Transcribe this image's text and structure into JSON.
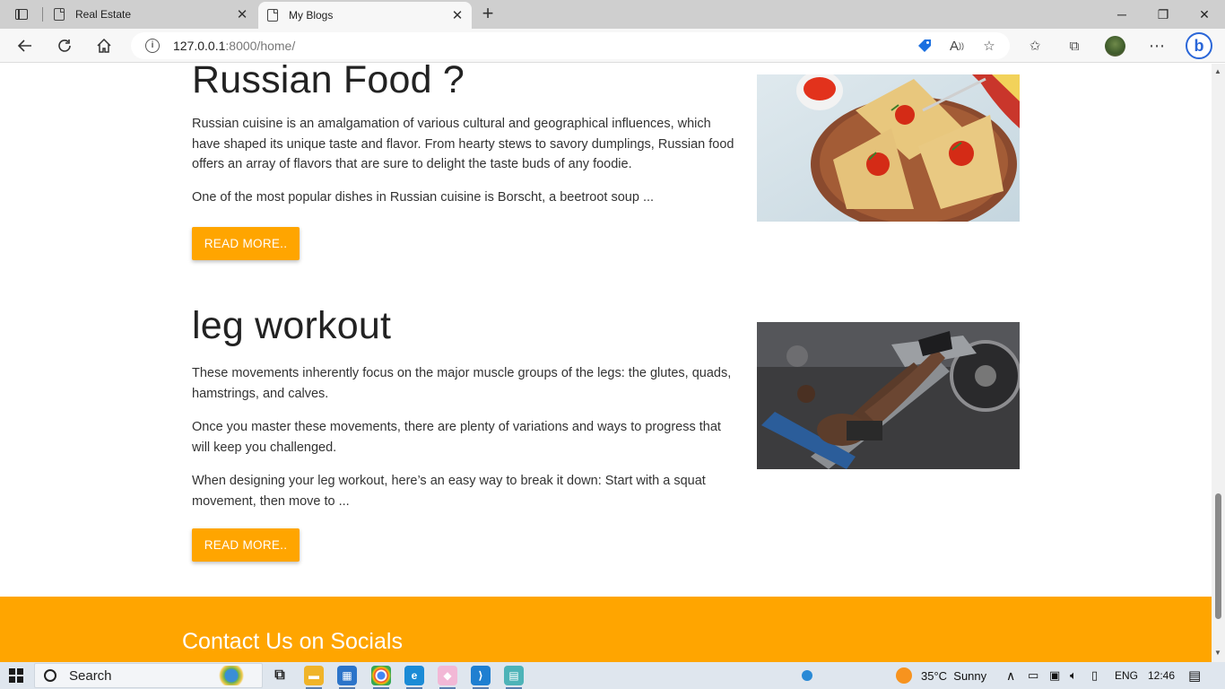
{
  "browser": {
    "tabs": [
      {
        "title": "Real Estate",
        "active": false
      },
      {
        "title": "My Blogs",
        "active": true
      }
    ],
    "url_host": "127.0.0.1",
    "url_rest": ":8000/home/",
    "window_controls": {
      "minimize": "─",
      "restore": "❐",
      "close": "✕"
    },
    "new_tab": "+"
  },
  "posts": [
    {
      "title": "Russian Food ?",
      "paragraphs": [
        "Russian cuisine is an amalgamation of various cultural and geographical influences, which have shaped its unique taste and flavor. From hearty stews to savory dumplings, Russian food offers an array of flavors that are sure to delight the taste buds of any foodie.",
        "One of the most popular dishes in Russian cuisine is Borscht, a beetroot soup ..."
      ],
      "button": "READ MORE..",
      "image": "pancakes-with-red-caviar"
    },
    {
      "title": "leg workout",
      "paragraphs": [
        "These movements inherently focus on the major muscle groups of the legs: the glutes, quads, hamstrings, and calves.",
        "Once you master these movements, there are plenty of variations and ways to progress that will keep you challenged.",
        "When designing your leg workout, here’s an easy way to break it down: Start with a squat movement, then move to ..."
      ],
      "button": "READ MORE..",
      "image": "leg-press-machine"
    }
  ],
  "footer": {
    "heading": "Contact Us on Socials"
  },
  "taskbar": {
    "search_label": "Search",
    "weather_temp": "35°C",
    "weather_text": "Sunny",
    "language": "ENG",
    "time": "12:46"
  },
  "colors": {
    "accent": "#ffa500",
    "taskbar": "#dfe6ee",
    "tabbar": "#cfcfcf"
  }
}
